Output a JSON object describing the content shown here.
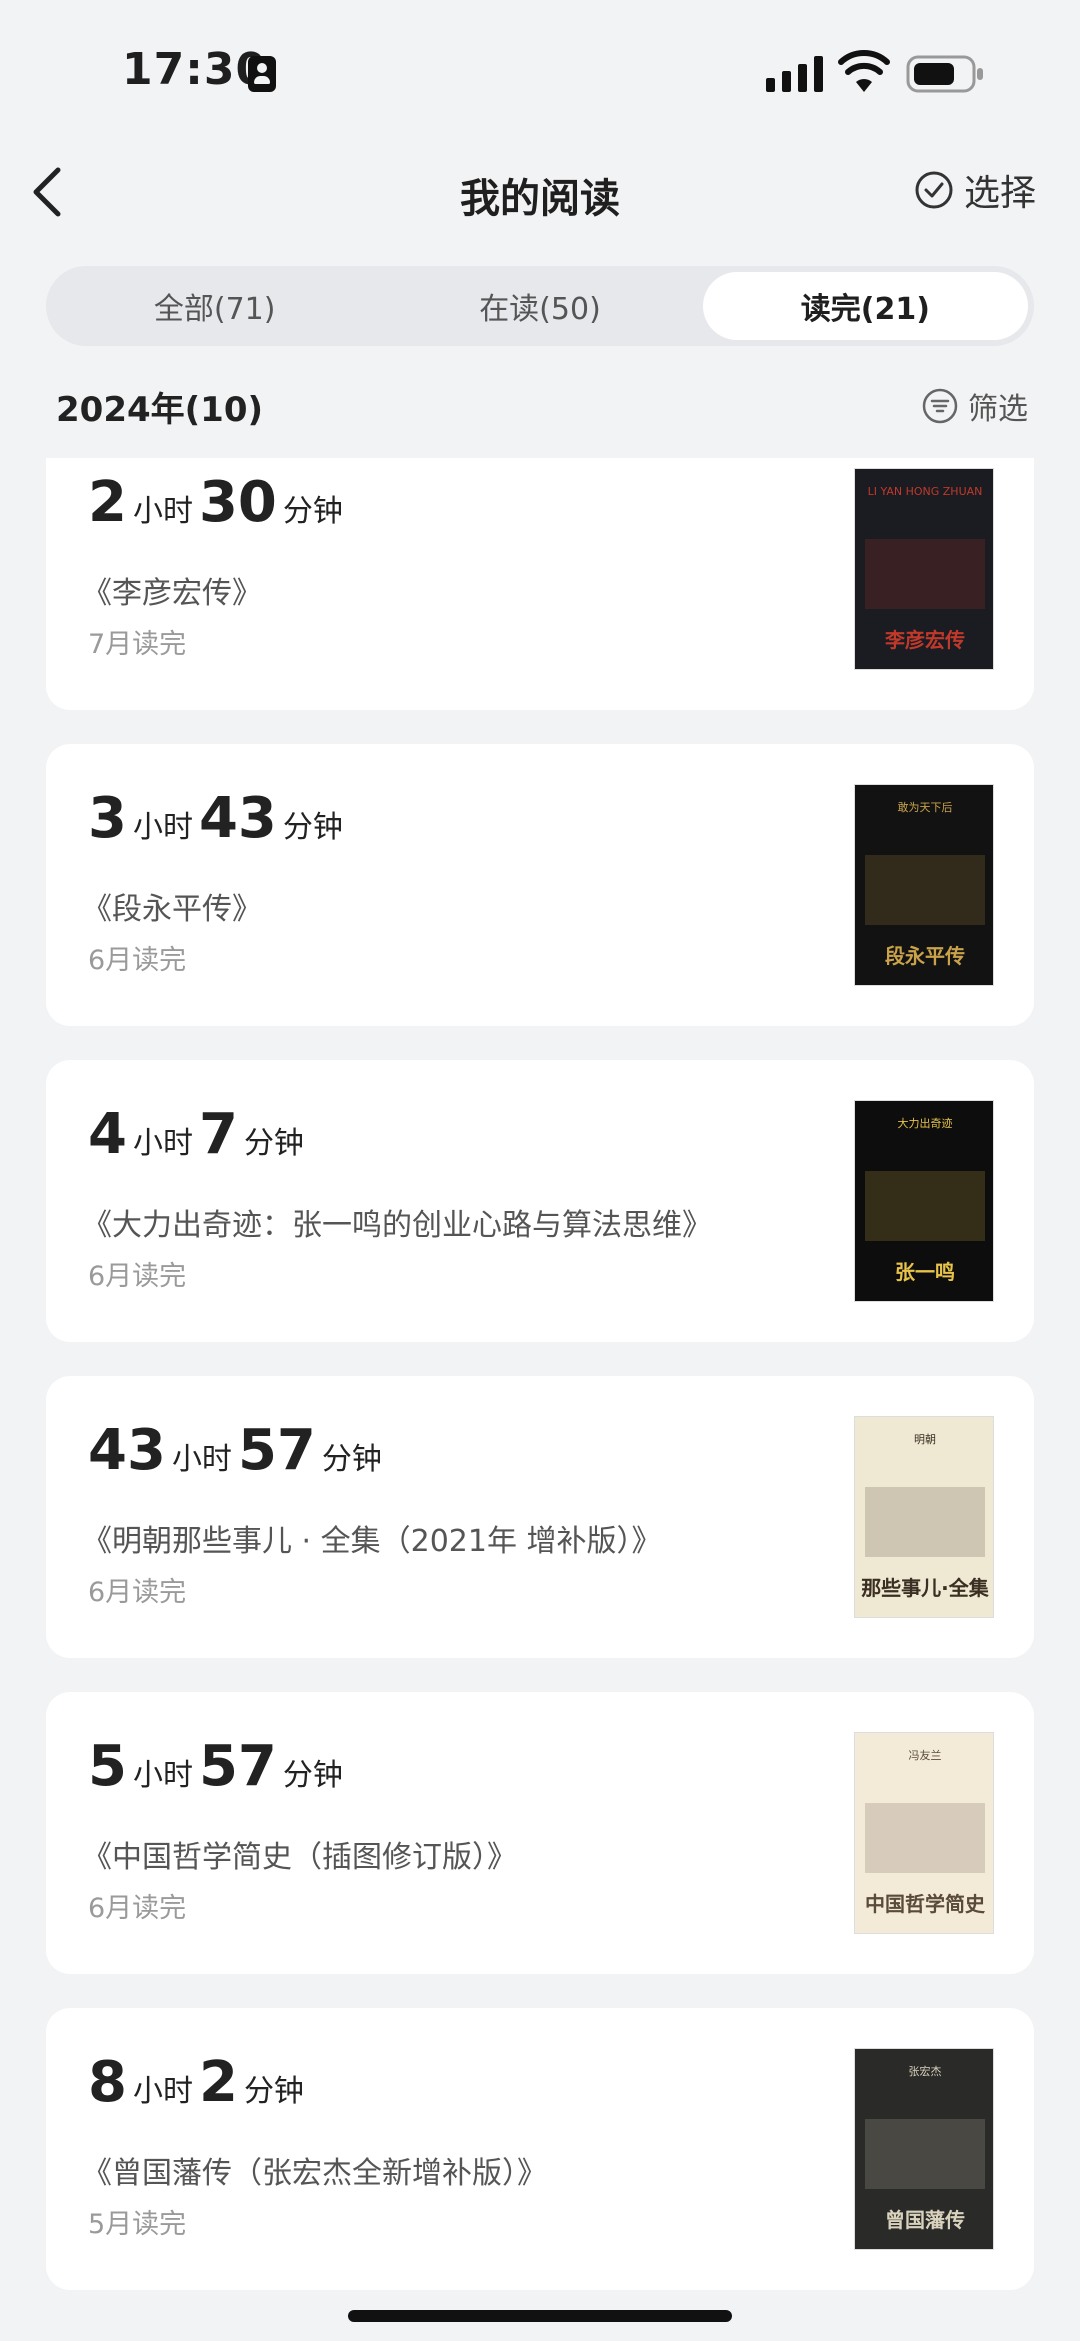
{
  "status_bar": {
    "time": "17:30"
  },
  "header": {
    "title": "我的阅读",
    "select_label": "选择"
  },
  "tabs": [
    {
      "label": "全部(71)"
    },
    {
      "label": "在读(50)"
    },
    {
      "label": "读完(21)"
    }
  ],
  "section": {
    "title": "2024年(10)",
    "filter_label": "筛选"
  },
  "units": {
    "hours": "小时",
    "minutes": "分钟"
  },
  "books": [
    {
      "hours": "2",
      "minutes": "30",
      "title": "《李彦宏传》",
      "finished": "7月读完",
      "cover": {
        "bg": "#1a1c22",
        "accent": "#c0392b",
        "top_text": "LI YAN HONG ZHUAN",
        "big_text": "李彦宏传"
      }
    },
    {
      "hours": "3",
      "minutes": "43",
      "title": "《段永平传》",
      "finished": "6月读完",
      "cover": {
        "bg": "#121212",
        "accent": "#c9a24a",
        "top_text": "敢为天下后",
        "big_text": "段永平传"
      }
    },
    {
      "hours": "4",
      "minutes": "7",
      "title": "《大力出奇迹：张一鸣的创业心路与算法思维》",
      "finished": "6月读完",
      "cover": {
        "bg": "#0d0d0d",
        "accent": "#e8c34a",
        "top_text": "大力出奇迹",
        "big_text": "张一鸣"
      }
    },
    {
      "hours": "43",
      "minutes": "57",
      "title": "《明朝那些事儿 · 全集（2021年 增补版）》",
      "finished": "6月读完",
      "cover": {
        "bg": "#efe8d2",
        "accent": "#3a2f22",
        "top_text": "明朝",
        "big_text": "那些事儿·全集"
      }
    },
    {
      "hours": "5",
      "minutes": "57",
      "title": "《中国哲学简史（插图修订版）》",
      "finished": "6月读完",
      "cover": {
        "bg": "#f3ead8",
        "accent": "#5a4a3a",
        "top_text": "冯友兰",
        "big_text": "中国哲学简史"
      }
    },
    {
      "hours": "8",
      "minutes": "2",
      "title": "《曾国藩传（张宏杰全新增补版）》",
      "finished": "5月读完",
      "cover": {
        "bg": "#2a2a28",
        "accent": "#d9d2bd",
        "top_text": "张宏杰",
        "big_text": "曾国藩传"
      }
    }
  ]
}
